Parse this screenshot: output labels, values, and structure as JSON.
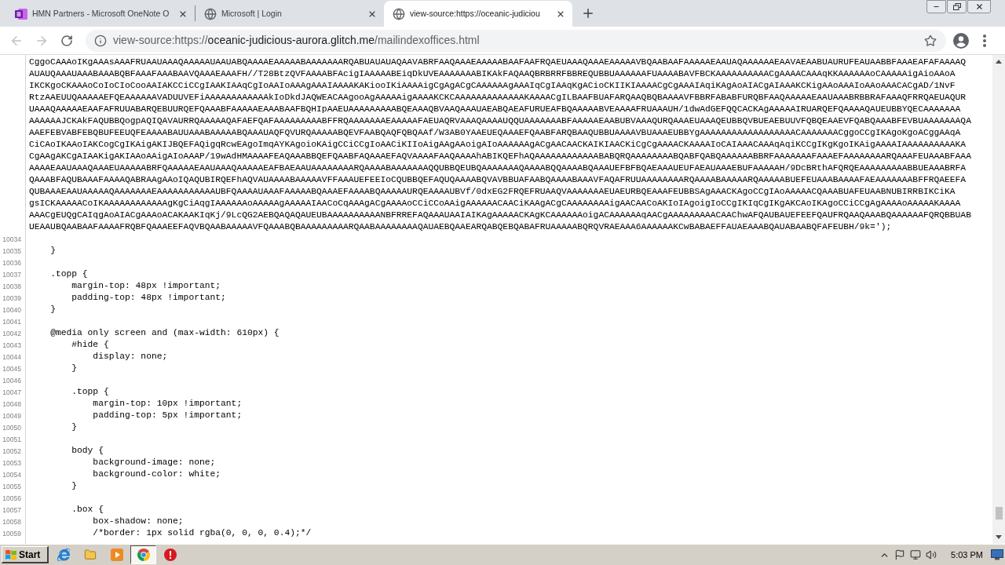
{
  "tabs": [
    {
      "kind": "onenote",
      "title": "HMN Partners - Microsoft OneNote O",
      "selected": false
    },
    {
      "kind": "globe",
      "title": "Microsoft | Login",
      "selected": false
    },
    {
      "kind": "globe",
      "title": "view-source:https://oceanic-judiciou",
      "selected": true
    }
  ],
  "toolbar": {
    "nav": [
      {
        "kind": "back",
        "disabled": true
      },
      {
        "kind": "forward",
        "disabled": true
      },
      {
        "kind": "reload",
        "disabled": false
      }
    ],
    "url": {
      "scheme": "view-source:https://",
      "host": "oceanic-judicious-aurora.glitch.me",
      "path": "/mailindexoffices.html"
    }
  },
  "source": {
    "wrapped": [
      "CggoCAAAoIKgAAAsAAAFRUAAUAAAQAAAAAUAAUABQAAAAEAAAAABAAAAAAARQABUAUAUAQAAVABRFAAQAAAEAAAAABAAFAAFRQAEUAAAQAAAEAAAAAVBQAABAAFAAAAAEAAUAQAAAAAAEAAVAEAABUAURUFEAUAABBFAAAEAFAFAAAAQ",
      "AUAUQAAAUAAABAAABQBFAAAFAAABAAVQAAAEAAAFH//T28BtzQVFAAAABFAcigIAAAAABEiqDkUVEAAAAAAABIKAkFAQAAQBRBRRFBBREQUBBUAAAAAAFUAAAABAVFBCKAAAAAAAAAACgAAAACAAAqKKAAAAAAoCAAAAAigAioAAoA",
      "IKCKgoCKAAAoCoIoCIoCooAAIAKCCiCCgIAAKIAAqCgIoAAIoAAAgAAAIAAAAKAKiooIKiAAAAigCgAgACgCAAAAAAgAAAIqCgIAAqKgACioCKIIKIAAAACgCgAAAIAqiKAgAoAIACgAIAAAKCKigAAoAAAIoAAoAAACACgAD/1NvF",
      "RtzAAEUUQAAAAAEFQEAAAAAAVADUUVEFiAAAAAAAAAAAAkIoDkdJAQWEACAAgooAgAAAAAigAAAAKCKCAAAAAAAAAAAAAKAAAACgILBAAFBUAFARQAAQBQBAAAAVFBBRFABABFURQBFAAQAAAAAEAAUAAABRBBRAFAAAQFRRQAEUAQUR",
      "UAAAQAAAAAEAAFAFRUUABARQEBUURQEFQAAABFAAAAAEAAABAAFBQHIpAAEUAAAAAAAAABQEAAAQBVAAQAAAUAEABQAEAFURUEAFBQAAAAABVEAAAAFRUAAAUH/1dwAdGEFQQCACKAgAAAAAIRUARQEFQAAAAQAUEUBBYQECAAAAAAA",
      "AAAAAAJCKAkFAQUBBQogpAQIQAVAURRQAAAAAQAFAEFQAFAAAAAAAAABFFRQAAAAAAAEAAAAAFAEUAQRVAAAQAAAAUQQUAAAAAAABFAAAAAEAABUBVAAAQURQAAAEUAAAQEUBBQVBUEAEBUUVFQBQEAAEVFQABQAAABFEVBUAAAAAAAQA",
      "AAEFEBVABFEBQBUFEEUQFEAAAABAUUAAABAAAAABQAAAUAQFQVURQAAAAABQEVFAABQAQFQBQAAf/W3AB0YAAEUEQAAAEFQAABFARQBAAQUBBUAAAAVBUAAAEUBBYgAAAAAAAAAAAAAAAAAACAAAAAAACggoCCgIKAgoKgoACggAAqA",
      "CiCAoIKAAoIAKCogCgIKAigAKIJBQEFAQigqRcwEAgoImqAYKAgoioKAigCCiCCgIoAACiKIIoAigAAgAAoigAIoAAAAAAgACgAACAACKAIKIAACKiCgCgAAAACKAAAAIoCAIAAACAAAqAqiKCCgIKgKgoIKAigAAAAIAAAAAAAAAAKA",
      "CgAAgAKCgAIAAKigAKIAAoAAigAIoAAAP/19wAdHMAAAAFEAQAAABBQEFQAABFAQAAAEFAQVAAAAFAAQAAAAhABIKQEFhAQAAAAAAAAAAAABABQRQAAAAAAAABQABFQABQAAAAAABBRFAAAAAAAFAAAEFAAAAAAAARQAAAFEUAAABFAAA",
      "AAAAEAAUAAAQAAAEUAAAAABRFQAAAAAEAAUAAAQAAAAAEAFBAEAAUAAAAAAAARQAAAABAAAAAAAQQUBBQEUBQAAAAAAAQAAAABQQAAAABQAAAUEFBFBQAEAAAUEUFAEAUAAAEBUFAAAAAH/9DcBRthAFQRQEAAAAAAAAABBUEAAABRFA",
      "QAAABFAQUBAAAFAAAAQABRAAgAAoIQAQUBIRQEFhAQVAUAAAABAAAAAVFFAAAUEFEEIoCQUBBQEFAQUQAAAABQVAVBBUAFAABQAAAABAAAVFAQAFRUUAAAAAAAARQAAAABAAAAARQAAAAABUEFEUAAABAAAAFAEAAAAAAABFFRQAEEFA",
      "QUBAAAEAAUAAAAAQAAAAAAAEAAAAAAAAAAAUBFQAAAAUAAAFAAAAABQAAAEFAAAABQAAAAAURQEAAAAUBVf/0dxEG2FRQEFRUAAQVAAAAAAAEUAEURBQEAAAFEUBBSAgAAACKAgoCCgIAoAAAAACQAAABUAFEUAABNUBIRRBIKCiKA",
      "gsICKAAAAACoIKAAAAAAAAAAAAgKgCiAqgIAAAAAAoAAAAAgAAAAAIAACoCqAAAgACgAAAAoCCiCCoAAigAAAAAACAACiKAAgACgCAAAAAAAAigAACAACoAKIoIAgoigIoCCgIKIqCgIKgAKCAoIKAgoCCiCCgAgAAAAoAAAAAKAAAA",
      "AAACgEUQgCAIqgAoAIACgAAAoACAKAAKIqKj/9LcQG2AEBQAQAQAUEUBAAAAAAAAAANBFRREFAQAAAUAAIAIKAgAAAAACKAgKCAAAAAAoigACAAAAAAqAACgAAAAAAAAACAAChwAFQAUBAUEFEEFQAUFRQAAQAAABQAAAAAAFQRQBBUAB",
      "UEAAUBQAABAAFAAAAFRQBFQAAAEEFAQVBQAABAAAAAVFQAAABQBAAAAAAAAARQAABAAAAAAAAQAUAEBQAAEARQABQEBQABAFRUAAAAABQRQVRAEAAA6AAAAAAKCwBABAEFFAUAEAAABQAUABAABQFAFEUBH/9k=');"
    ],
    "lines": [
      {
        "number": "10034"
      },
      {
        "number": "10035",
        "text": "    }"
      },
      {
        "number": "10036"
      },
      {
        "number": "10037",
        "text": "    .topp {"
      },
      {
        "number": "10038",
        "text": "        margin-top: 48px !important;"
      },
      {
        "number": "10039",
        "text": "        padding-top: 48px !important;"
      },
      {
        "number": "10040",
        "text": "    }"
      },
      {
        "number": "10041"
      },
      {
        "number": "10042",
        "text": "    @media only screen and (max-width: 610px) {"
      },
      {
        "number": "10043",
        "text": "        #hide {"
      },
      {
        "number": "10044",
        "text": "            display: none;"
      },
      {
        "number": "10045",
        "text": "        }"
      },
      {
        "number": "10046"
      },
      {
        "number": "10047",
        "text": "        .topp {"
      },
      {
        "number": "10048",
        "text": "            margin-top: 10px !important;"
      },
      {
        "number": "10049",
        "text": "            padding-top: 5px !important;"
      },
      {
        "number": "10050",
        "text": "        }"
      },
      {
        "number": "10051"
      },
      {
        "number": "10052",
        "text": "        body {"
      },
      {
        "number": "10053",
        "text": "            background-image: none;"
      },
      {
        "number": "10054",
        "text": "            background-color: white;"
      },
      {
        "number": "10055",
        "text": "        }"
      },
      {
        "number": "10056"
      },
      {
        "number": "10057",
        "text": "        .box {"
      },
      {
        "number": "10058",
        "text": "            box-shadow: none;"
      },
      {
        "number": "10059",
        "text": "            /*border: 1px solid rgba(0, 0, 0, 0.4);*/"
      }
    ]
  },
  "taskbar": {
    "start": "Start",
    "apps": [
      {
        "kind": "ie",
        "selected": false
      },
      {
        "kind": "folder",
        "selected": false
      },
      {
        "kind": "media",
        "selected": false
      },
      {
        "kind": "chrome",
        "selected": true
      },
      {
        "kind": "stop",
        "selected": false
      }
    ],
    "clock": "5:03 PM"
  }
}
